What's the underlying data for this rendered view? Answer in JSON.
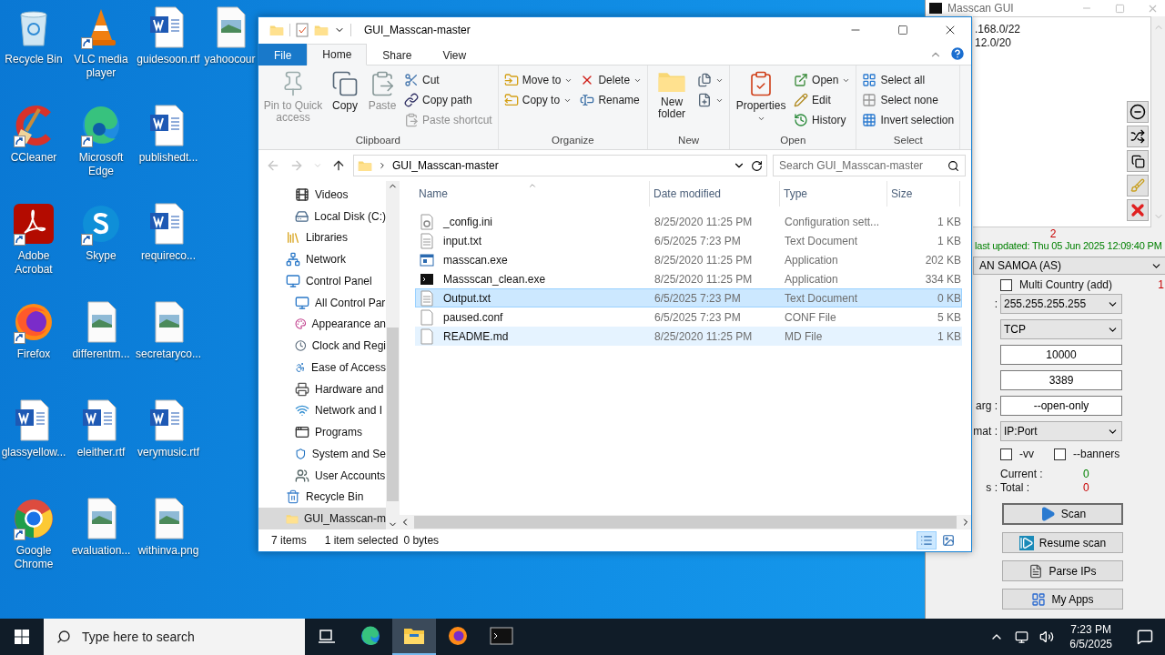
{
  "desktop": {
    "columns": [
      {
        "icons": [
          {
            "label": "Recycle Bin",
            "kind": "recycle",
            "shortcut": false
          },
          {
            "label": "CCleaner",
            "kind": "ccleaner",
            "shortcut": true
          },
          {
            "label": "Adobe Acrobat",
            "kind": "acrobat",
            "shortcut": true
          },
          {
            "label": "Firefox",
            "kind": "firefox",
            "shortcut": true
          },
          {
            "label": "glassyellow...",
            "kind": "word",
            "shortcut": false
          },
          {
            "label": "Google Chrome",
            "kind": "chrome",
            "shortcut": true
          }
        ]
      },
      {
        "icons": [
          {
            "label": "VLC media player",
            "kind": "vlc",
            "shortcut": true
          },
          {
            "label": "Microsoft Edge",
            "kind": "edge",
            "shortcut": true
          },
          {
            "label": "Skype",
            "kind": "skype",
            "shortcut": true
          },
          {
            "label": "differentm...",
            "kind": "image",
            "shortcut": false
          },
          {
            "label": "eleither.rtf",
            "kind": "word",
            "shortcut": false
          },
          {
            "label": "evaluation...",
            "kind": "image",
            "shortcut": false
          }
        ]
      },
      {
        "icons": [
          {
            "label": "guidesoon.rtf",
            "kind": "word",
            "shortcut": false
          },
          {
            "label": "publishedt...",
            "kind": "word",
            "shortcut": false
          },
          {
            "label": "requireco...",
            "kind": "word",
            "shortcut": false
          },
          {
            "label": "secretaryco...",
            "kind": "image",
            "shortcut": false
          },
          {
            "label": "verymusic.rtf",
            "kind": "word",
            "shortcut": false
          },
          {
            "label": "withinva.png",
            "kind": "image",
            "shortcut": false
          }
        ]
      },
      {
        "icons": [
          {
            "label": "yahoocour",
            "kind": "image",
            "shortcut": false
          }
        ]
      }
    ]
  },
  "explorer": {
    "title": "GUI_Masscan-master",
    "tabs": [
      {
        "label": "File",
        "kind": "file",
        "selected": false
      },
      {
        "label": "Home",
        "kind": "tab",
        "selected": true
      },
      {
        "label": "Share",
        "kind": "tab",
        "selected": false
      },
      {
        "label": "View",
        "kind": "tab",
        "selected": false
      }
    ],
    "ribbon": [
      {
        "label": "Clipboard",
        "columns": [
          {
            "kind": "large",
            "items": [
              {
                "label": "Pin to Quick access",
                "disabled": true,
                "dropdown": false
              }
            ]
          },
          {
            "kind": "large",
            "items": [
              {
                "label": "Copy",
                "disabled": false,
                "dropdown": false
              }
            ]
          },
          {
            "kind": "large",
            "items": [
              {
                "label": "Paste",
                "disabled": true,
                "dropdown": false
              }
            ]
          },
          {
            "kind": "small",
            "items": [
              {
                "label": "Cut",
                "disabled": false,
                "dropdown": false
              },
              {
                "label": "Copy path",
                "disabled": false,
                "dropdown": false
              },
              {
                "label": "Paste shortcut",
                "disabled": true,
                "dropdown": false
              }
            ]
          }
        ]
      },
      {
        "label": "Organize",
        "columns": [
          {
            "kind": "small",
            "items": [
              {
                "label": "Move to",
                "disabled": false,
                "dropdown": true
              },
              {
                "label": "Copy to",
                "disabled": false,
                "dropdown": true
              }
            ]
          },
          {
            "kind": "small",
            "items": [
              {
                "label": "Delete",
                "disabled": false,
                "dropdown": true
              },
              {
                "label": "Rename",
                "disabled": false,
                "dropdown": false
              }
            ]
          }
        ]
      },
      {
        "label": "New",
        "columns": [
          {
            "kind": "large",
            "items": [
              {
                "label": "New folder",
                "disabled": false,
                "dropdown": false
              }
            ]
          },
          {
            "kind": "small",
            "items": [
              {
                "disabled": false,
                "dropdown": true
              },
              {
                "disabled": false,
                "dropdown": true
              }
            ]
          }
        ]
      },
      {
        "label": "Open",
        "columns": [
          {
            "kind": "large",
            "items": [
              {
                "label": "Properties",
                "disabled": false,
                "dropdown": true
              }
            ]
          },
          {
            "kind": "small",
            "items": [
              {
                "label": "Open",
                "disabled": false,
                "dropdown": true
              },
              {
                "label": "Edit",
                "disabled": false,
                "dropdown": false
              },
              {
                "label": "History",
                "disabled": false,
                "dropdown": false
              }
            ]
          }
        ]
      },
      {
        "label": "Select",
        "columns": [
          {
            "kind": "small",
            "items": [
              {
                "label": "Select all",
                "disabled": false,
                "dropdown": false
              },
              {
                "label": "Select none",
                "disabled": false,
                "dropdown": false
              },
              {
                "label": "Invert selection",
                "disabled": false,
                "dropdown": false
              }
            ]
          }
        ]
      }
    ],
    "address": {
      "path": "GUI_Masscan-master",
      "search_placeholder": "Search GUI_Masscan-master"
    },
    "nav_pane": {
      "this_pc_children": [
        {
          "label": "Videos",
          "selected": false
        },
        {
          "label": "Local Disk (C:)",
          "selected": false
        }
      ],
      "items": [
        {
          "label": "Libraries",
          "selected": false
        },
        {
          "label": "Network",
          "selected": false
        },
        {
          "label": "Control Panel",
          "selected": false,
          "children": [
            {
              "label": "All Control Par",
              "selected": false
            },
            {
              "label": "Appearance an",
              "selected": false
            },
            {
              "label": "Clock and Regi",
              "selected": false
            },
            {
              "label": "Ease of Access",
              "selected": false
            },
            {
              "label": "Hardware and",
              "selected": false
            },
            {
              "label": "Network and I",
              "selected": false
            },
            {
              "label": "Programs",
              "selected": false
            },
            {
              "label": "System and Se",
              "selected": false
            },
            {
              "label": "User Accounts",
              "selected": false
            }
          ]
        },
        {
          "label": "Recycle Bin",
          "selected": false
        },
        {
          "label": "GUI_Masscan-m",
          "selected": true
        }
      ]
    },
    "columns": [
      "Name",
      "Date modified",
      "Type",
      "Size"
    ],
    "files": [
      {
        "name": "_config.ini",
        "kind": "settings",
        "date": "8/25/2020 11:25 PM",
        "type": "Configuration sett...",
        "size": "1 KB",
        "selected": false,
        "hovered": false
      },
      {
        "name": "input.txt",
        "kind": "text",
        "date": "6/5/2025 7:23 PM",
        "type": "Text Document",
        "size": "1 KB",
        "selected": false,
        "hovered": false
      },
      {
        "name": "masscan.exe",
        "kind": "app",
        "date": "8/25/2020 11:25 PM",
        "type": "Application",
        "size": "202 KB",
        "selected": false,
        "hovered": false
      },
      {
        "name": "Massscan_clean.exe",
        "kind": "console",
        "date": "8/25/2020 11:25 PM",
        "type": "Application",
        "size": "334 KB",
        "selected": false,
        "hovered": false
      },
      {
        "name": "Output.txt",
        "kind": "text",
        "date": "6/5/2025 7:23 PM",
        "type": "Text Document",
        "size": "0 KB",
        "selected": true,
        "hovered": false
      },
      {
        "name": "paused.conf",
        "kind": "blank",
        "date": "6/5/2025 7:23 PM",
        "type": "CONF File",
        "size": "5 KB",
        "selected": false,
        "hovered": false
      },
      {
        "name": "README.md",
        "kind": "blank",
        "date": "8/25/2020 11:25 PM",
        "type": "MD File",
        "size": "1 KB",
        "selected": false,
        "hovered": true
      }
    ],
    "status": {
      "count": "7 items",
      "selection": "1 item selected",
      "bytes": "0 bytes"
    },
    "views": [
      {
        "kind": "details",
        "selected": true
      },
      {
        "kind": "tiles",
        "selected": false
      }
    ]
  },
  "masscan": {
    "title": "Masscan GUI",
    "ranges": [
      ".168.0/22",
      "12.0/20"
    ],
    "count": "2",
    "last_updated": "last updated: Thu 05 Jun 2025 12:09:40 PM",
    "country": "AN SAMOA (AS)",
    "multi_country": {
      "label": "Multi Country (add)",
      "checked": false
    },
    "counter": "1",
    "fields": [
      {
        "label": ":",
        "kind": "select",
        "value": "255.255.255.255"
      },
      {
        "kind": "select",
        "value": "TCP"
      },
      {
        "kind": "input",
        "value": "10000"
      },
      {
        "kind": "input",
        "value": "3389"
      },
      {
        "label": "arg :",
        "kind": "input",
        "value": "--open-only"
      },
      {
        "label": "mat :",
        "kind": "select",
        "value": "IP:Port"
      }
    ],
    "options": [
      {
        "label": "-vv",
        "checked": false
      },
      {
        "label": "--banners",
        "checked": false
      }
    ],
    "status_label": "s :",
    "current": {
      "label": "Current :",
      "value": "0"
    },
    "total": {
      "label": "Total :",
      "value": "0"
    },
    "buttons": [
      {
        "label": "Scan",
        "kind": "scan",
        "default": true
      },
      {
        "label": "Resume scan",
        "kind": "resume",
        "default": false
      },
      {
        "label": "Parse IPs",
        "kind": "parse",
        "default": false
      },
      {
        "label": "My Apps",
        "kind": "apps",
        "default": false
      }
    ]
  },
  "taskbar": {
    "search_placeholder": "Type here to search",
    "apps": [
      {
        "kind": "taskview",
        "active": false
      },
      {
        "kind": "edge",
        "active": false
      },
      {
        "kind": "explorer",
        "active": true
      },
      {
        "kind": "firefox",
        "active": false
      },
      {
        "kind": "terminal",
        "active": false
      }
    ],
    "time": "7:23 PM",
    "date": "6/5/2025"
  }
}
